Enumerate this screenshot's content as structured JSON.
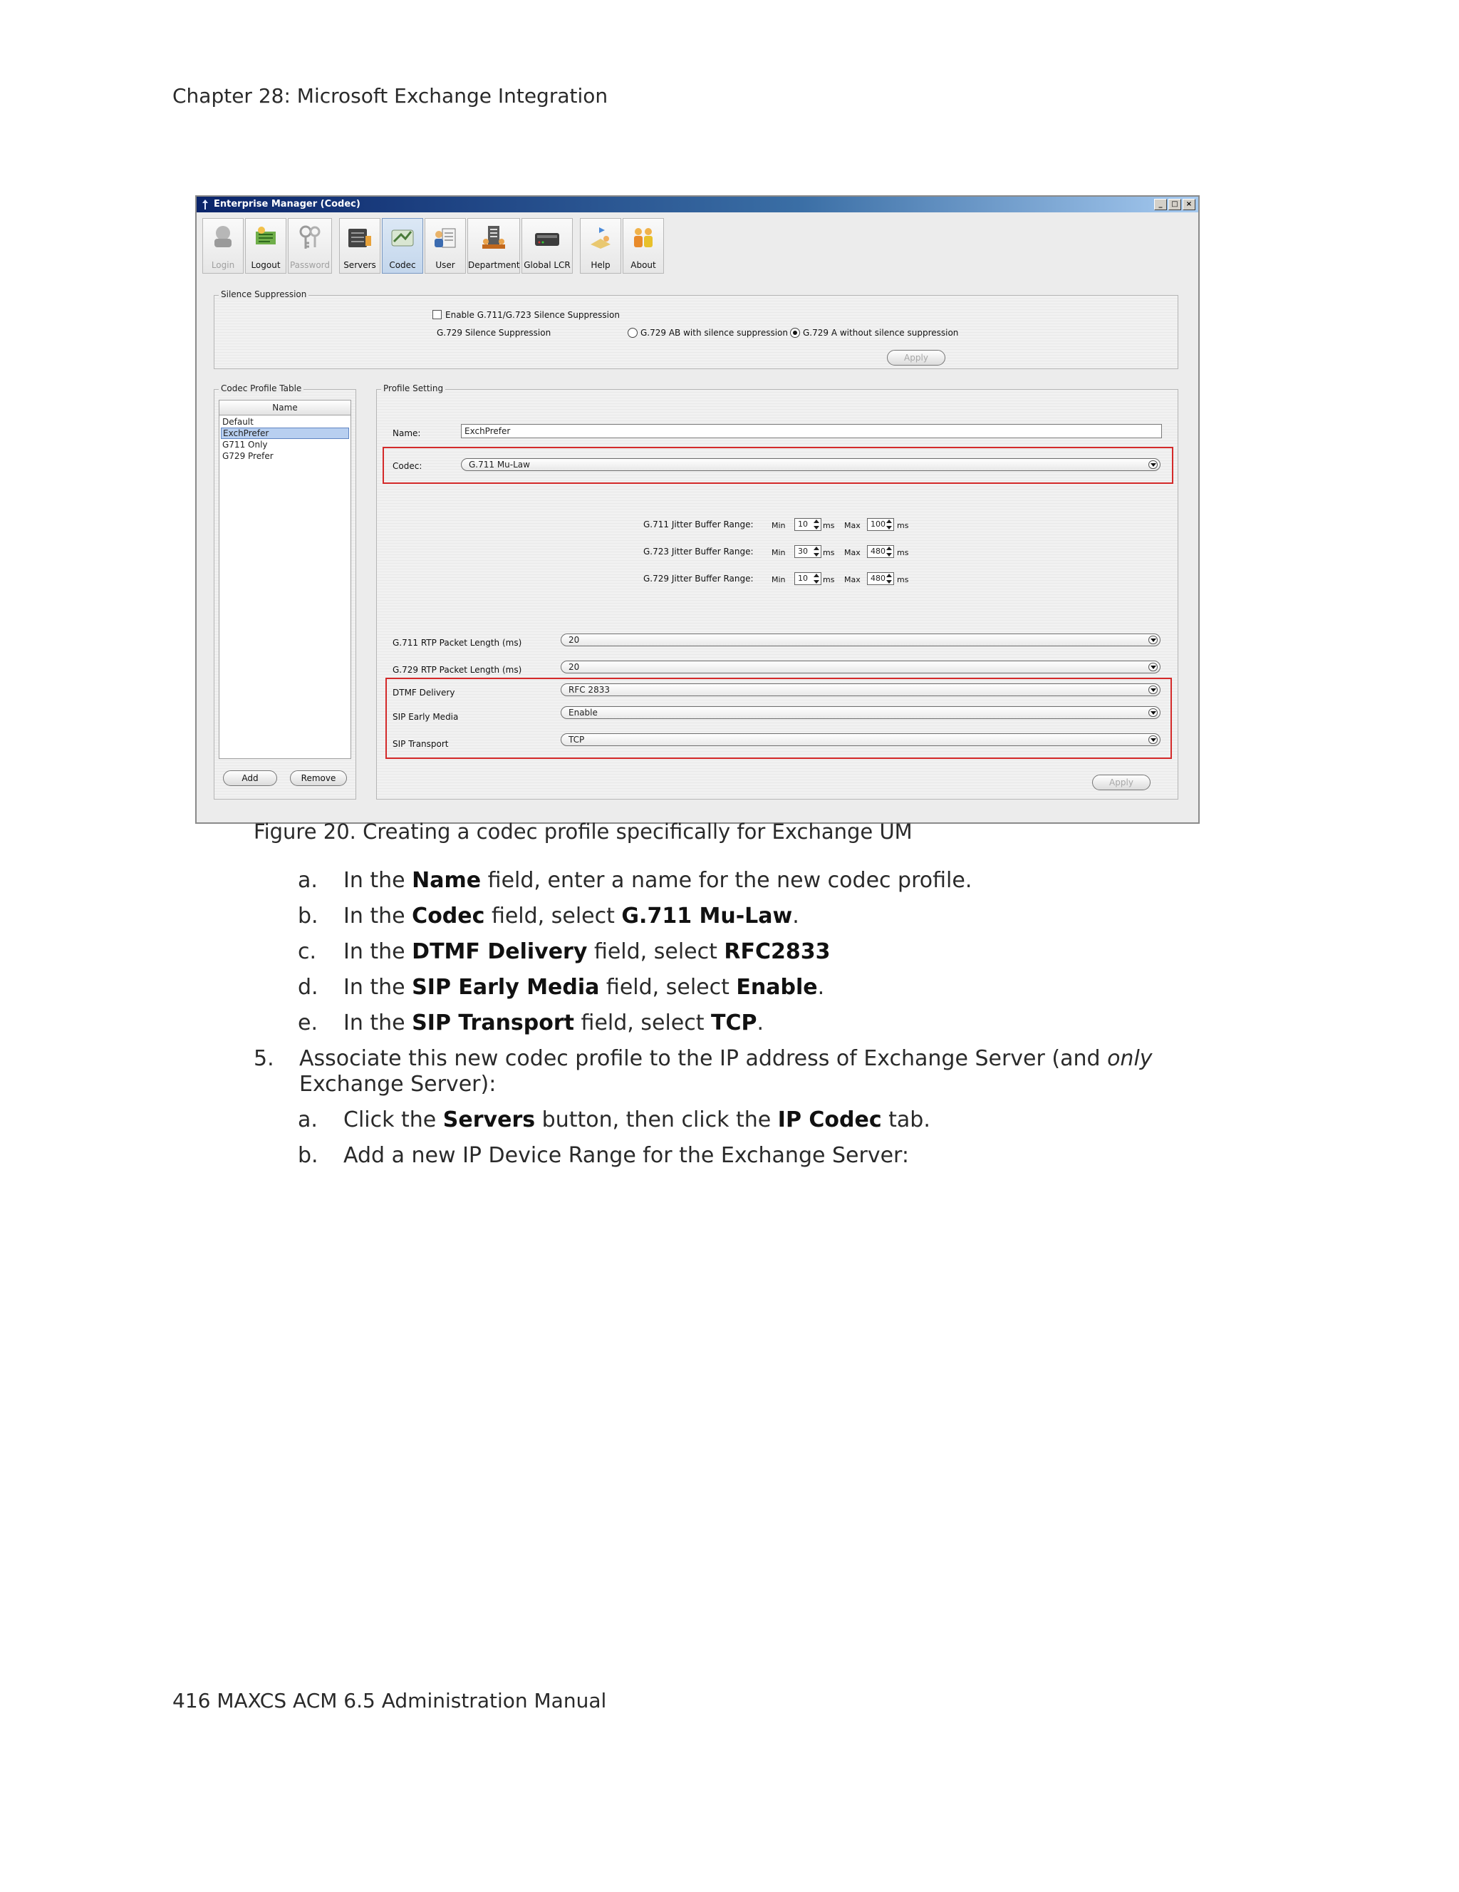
{
  "header": {
    "chapter": "Chapter 28:  Microsoft Exchange Integration"
  },
  "window": {
    "title": "Enterprise Manager  (Codec)",
    "controls": [
      "_",
      "□",
      "×"
    ],
    "toolbar": [
      {
        "label": "Login",
        "icon": "login-icon",
        "enabled": false
      },
      {
        "label": "Logout",
        "icon": "logout-icon",
        "enabled": true
      },
      {
        "label": "Password",
        "icon": "password-icon",
        "enabled": false
      },
      {
        "label": "Servers",
        "icon": "servers-icon",
        "enabled": true
      },
      {
        "label": "Codec",
        "icon": "codec-icon",
        "enabled": true,
        "active": true
      },
      {
        "label": "User",
        "icon": "user-icon",
        "enabled": true
      },
      {
        "label": "Department",
        "icon": "department-icon",
        "enabled": true
      },
      {
        "label": "Global LCR",
        "icon": "global-lcr-icon",
        "enabled": true
      },
      {
        "label": "Help",
        "icon": "help-icon",
        "enabled": true
      },
      {
        "label": "About",
        "icon": "about-icon",
        "enabled": true
      }
    ],
    "silence": {
      "title": "Silence Suppression",
      "enable_label": "Enable G.711/G.723 Silence Suppression",
      "g729_label": "G.729 Silence Suppression",
      "option_ab": "G.729 AB with silence suppression",
      "option_a": "G.729 A without silence suppression",
      "apply": "Apply"
    },
    "profile_table": {
      "title": "Codec Profile Table",
      "column": "Name",
      "rows": [
        "Default",
        "ExchPrefer",
        "G711 Only",
        "G729 Prefer"
      ],
      "add": "Add",
      "remove": "Remove"
    },
    "profile_setting": {
      "title": "Profile Setting",
      "name_label": "Name:",
      "name_value": "ExchPrefer",
      "codec_label": "Codec:",
      "codec_value": "G.711 Mu-Law",
      "jitter": [
        {
          "label": "G.711 Jitter Buffer Range:",
          "min": "10",
          "max": "100"
        },
        {
          "label": "G.723 Jitter Buffer Range:",
          "min": "30",
          "max": "480"
        },
        {
          "label": "G.729 Jitter Buffer Range:",
          "min": "10",
          "max": "480"
        }
      ],
      "min_label": "Min",
      "max_label": "Max",
      "ms_label": "ms",
      "g711_rtp_label": "G.711 RTP Packet Length (ms)",
      "g711_rtp_value": "20",
      "g729_rtp_label": "G.729 RTP Packet Length (ms)",
      "g729_rtp_value": "20",
      "dtmf_label": "DTMF Delivery",
      "dtmf_value": "RFC 2833",
      "early_label": "SIP Early Media",
      "early_value": "Enable",
      "transport_label": "SIP Transport",
      "transport_value": "TCP",
      "apply": "Apply"
    }
  },
  "caption": "Figure 20.   Creating a codec profile specifically for Exchange UM",
  "steps": {
    "a1": {
      "marker": "a.",
      "pre": "In the ",
      "b1": "Name",
      "post": " field, enter a name for the new codec profile."
    },
    "b1": {
      "marker": "b.",
      "pre": "In the ",
      "b1": "Codec",
      "mid": " field, select ",
      "b2": "G.711 Mu-Law",
      "post": "."
    },
    "c1": {
      "marker": "c.",
      "pre": "In the ",
      "b1": "DTMF Delivery",
      "mid": " field, select ",
      "b2": "RFC2833"
    },
    "d1": {
      "marker": "d.",
      "pre": "In the ",
      "b1": "SIP Early Media",
      "mid": " field, select ",
      "b2": "Enable",
      "post": "."
    },
    "e1": {
      "marker": "e.",
      "pre": "In the ",
      "b1": "SIP Transport",
      "mid": " field, select ",
      "b2": "TCP",
      "post": "."
    },
    "five": {
      "marker": "5.",
      "line1_pre": "Associate this new codec profile to the IP address of Exchange Server (and ",
      "line1_em": "only",
      "line2": "Exchange Server):"
    },
    "a2": {
      "marker": "a.",
      "pre": "Click the ",
      "b1": "Servers",
      "mid": " button, then click the ",
      "b2": "IP Codec",
      "post": " tab."
    },
    "b2": {
      "marker": "b.",
      "text": "Add a new IP Device Range for the Exchange Server:"
    }
  },
  "footer": {
    "text": "416   MAXCS ACM 6.5 Administration Manual"
  }
}
